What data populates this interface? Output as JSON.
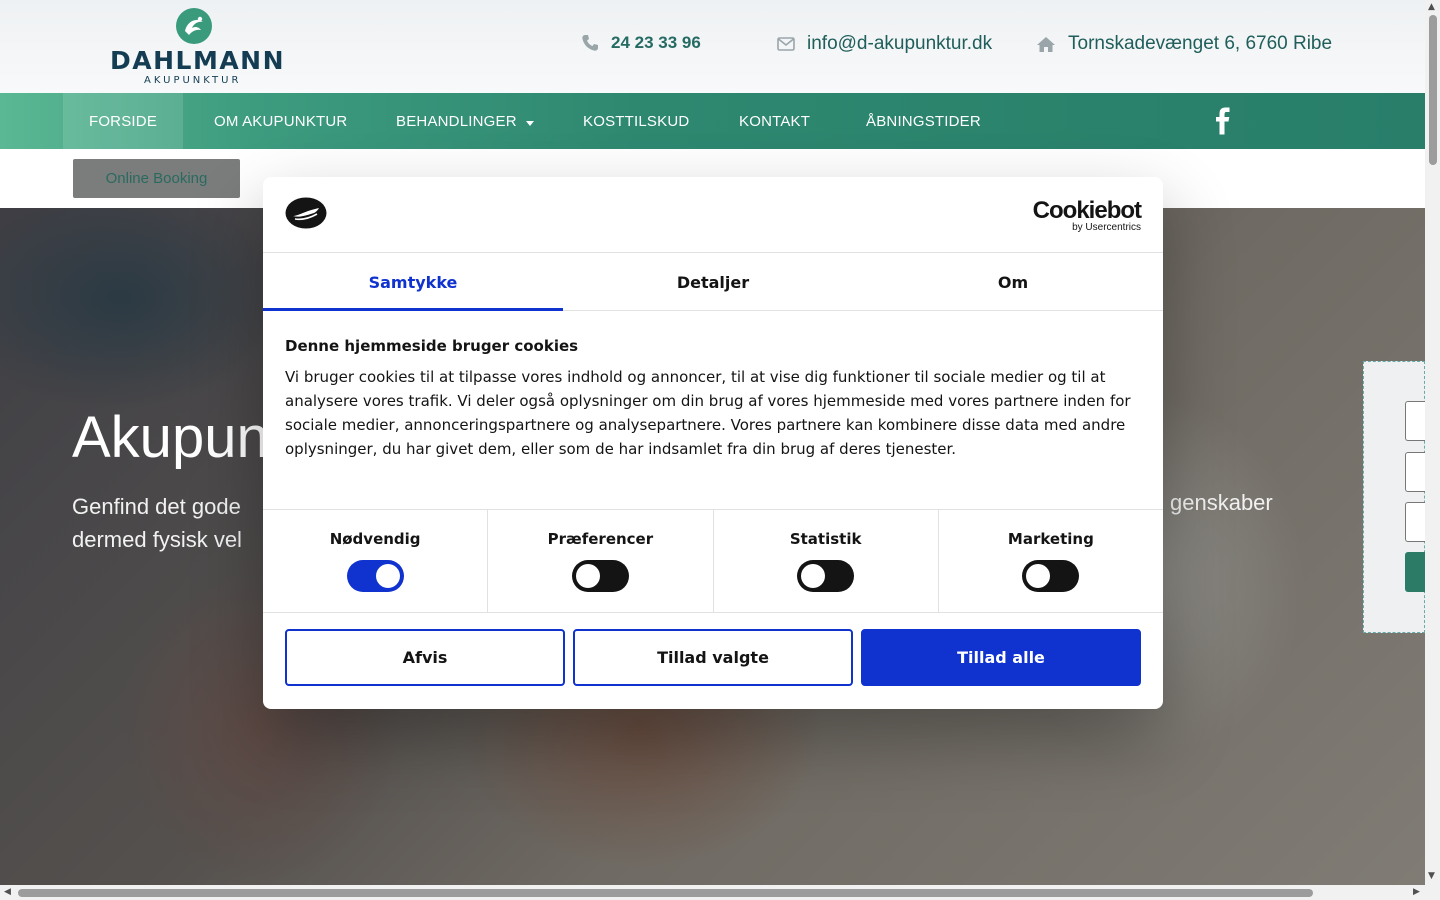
{
  "brand": {
    "name": "DAHLMANN",
    "sub": "AKUPUNKTUR"
  },
  "contact": {
    "phone": "24 23 33 96",
    "email": "info@d-akupunktur.dk",
    "address": "Tornskadevænget 6, 6760 Ribe"
  },
  "nav": {
    "items": [
      {
        "label": "FORSIDE",
        "active": true
      },
      {
        "label": "OM AKUPUNKTUR"
      },
      {
        "label": "BEHANDLINGER",
        "has_dropdown": true
      },
      {
        "label": "KOSTTILSKUD"
      },
      {
        "label": "KONTAKT"
      },
      {
        "label": "ÅBNINGSTIDER"
      }
    ],
    "social_icon": "facebook-icon"
  },
  "booking": {
    "label": "Online Booking"
  },
  "hero": {
    "headline_visible": "Akupun",
    "text_line1_left": "Genfind det gode",
    "text_line1_right": "genskaber",
    "text_line2_left": "dermed fysisk vel"
  },
  "cookie": {
    "brand": {
      "name": "Cookiebot",
      "sub": "by Usercentrics"
    },
    "tabs": [
      {
        "label": "Samtykke",
        "active": true
      },
      {
        "label": "Detaljer"
      },
      {
        "label": "Om"
      }
    ],
    "title": "Denne hjemmeside bruger cookies",
    "body": "Vi bruger cookies til at tilpasse vores indhold og annoncer, til at vise dig funktioner til sociale medier og til at analysere vores trafik. Vi deler også oplysninger om din brug af vores hjemmeside med vores partnere inden for sociale medier, annonceringspartnere og analysepartnere. Vores partnere kan kombinere disse data med andre oplysninger, du har givet dem, eller som de har indsamlet fra din brug af deres tjenester.",
    "categories": [
      {
        "label": "Nødvendig",
        "enabled": true
      },
      {
        "label": "Præferencer",
        "enabled": false
      },
      {
        "label": "Statistik",
        "enabled": false
      },
      {
        "label": "Marketing",
        "enabled": false
      }
    ],
    "buttons": {
      "deny": "Afvis",
      "allow_selected": "Tillad valgte",
      "allow_all": "Tillad alle"
    }
  },
  "colors": {
    "nav_green": "#2e8870",
    "brand_navy": "#143d53",
    "cookie_blue": "#1032cf"
  }
}
